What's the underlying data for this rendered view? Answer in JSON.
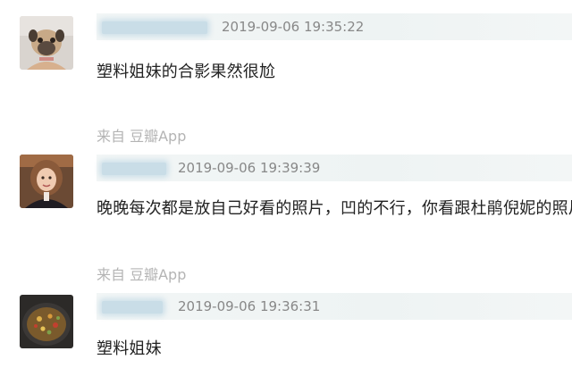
{
  "comments": [
    {
      "timestamp": "2019-09-06 19:35:22",
      "text": "塑料姐妹的合影果然很尬",
      "avatar_icon": "pug-dog-avatar"
    },
    {
      "source": "来自 豆瓣App",
      "timestamp": "2019-09-06 19:39:39",
      "text": "晚晚每次都是放自己好看的照片，凹的不行，你看跟杜鹃倪妮的照片",
      "avatar_icon": "girl-portrait-avatar"
    },
    {
      "source": "来自 豆瓣App",
      "timestamp": "2019-09-06 19:36:31",
      "text": "塑料姐妹",
      "avatar_icon": "food-plate-avatar"
    }
  ]
}
